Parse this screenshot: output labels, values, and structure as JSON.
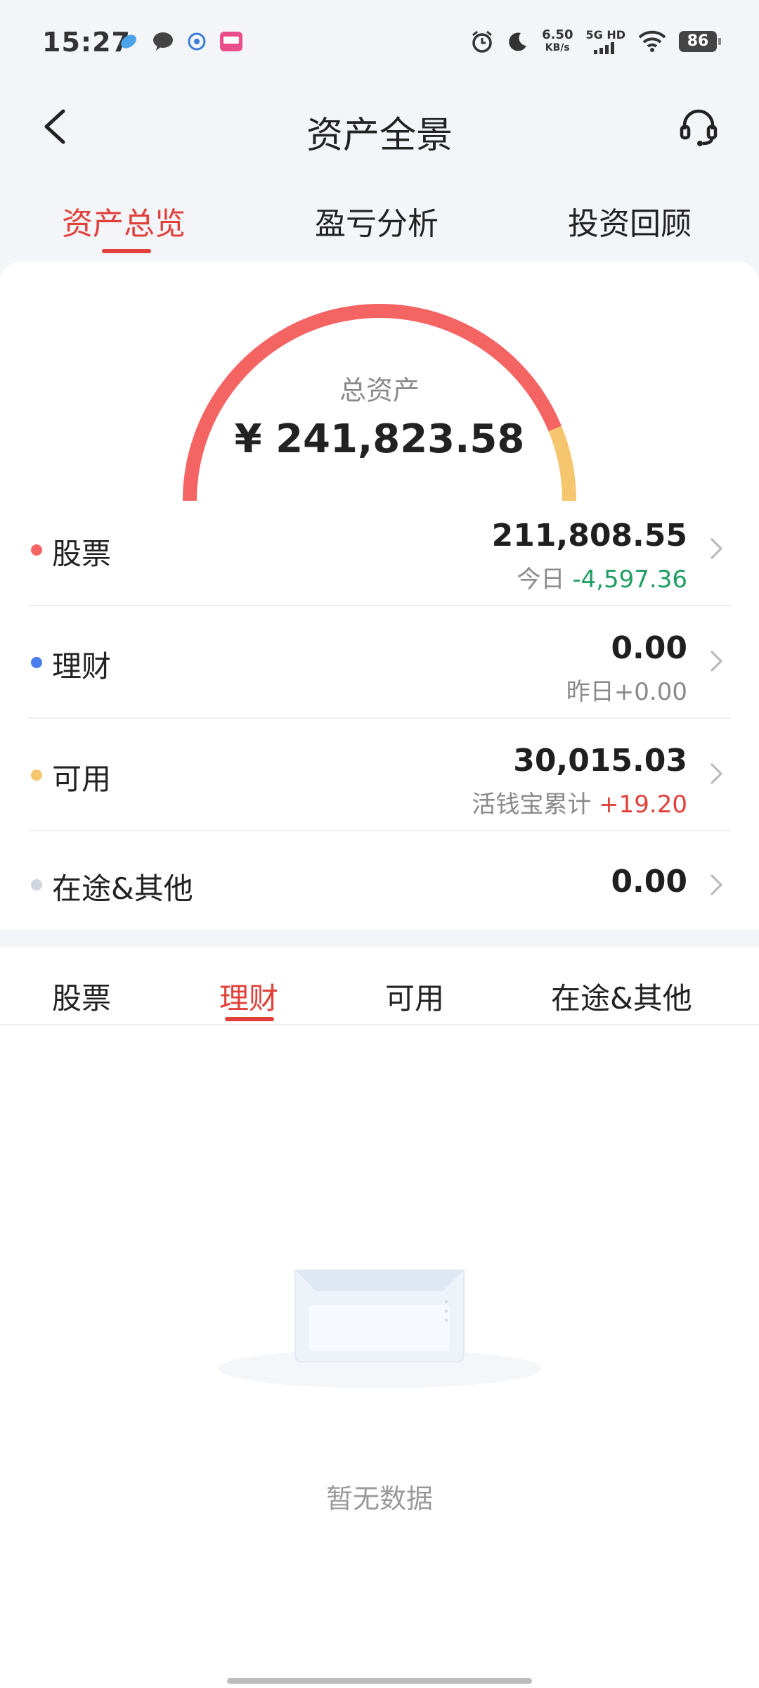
{
  "status_bar": {
    "time": "15:27",
    "speed_top": "6.50",
    "speed_unit": "KB/s",
    "network": "5G HD",
    "battery": "86"
  },
  "header": {
    "title": "资产全景",
    "back_icon": "chevron-left-icon",
    "service_icon": "headset-icon"
  },
  "top_tabs": [
    {
      "label": "资产总览",
      "active": true
    },
    {
      "label": "盈亏分析",
      "active": false
    },
    {
      "label": "投资回顾",
      "active": false
    }
  ],
  "summary": {
    "label": "总资产",
    "value": "¥ 241,823.58",
    "gauge_colors": {
      "stock": "#f36463",
      "available": "#f6c66f"
    },
    "gauge_shares": {
      "stock": 211808.55,
      "available": 30015.03
    }
  },
  "assets": [
    {
      "label": "股票",
      "dot_color": "#f36463",
      "value": "211,808.55",
      "sub_prefix": "今日 ",
      "sub_value": "-4,597.36",
      "sub_tone": "neg"
    },
    {
      "label": "理财",
      "dot_color": "#4a7ef0",
      "value": "0.00",
      "sub_prefix": "昨日",
      "sub_value": "+0.00",
      "sub_tone": "neutral"
    },
    {
      "label": "可用",
      "dot_color": "#f6c66f",
      "value": "30,015.03",
      "sub_prefix": "活钱宝累计 ",
      "sub_value": "+19.20",
      "sub_tone": "pos"
    },
    {
      "label": "在途&其他",
      "dot_color": "#cfd4de",
      "value": "0.00"
    }
  ],
  "sub_tabs": [
    {
      "label": "股票",
      "active": false
    },
    {
      "label": "理财",
      "active": true
    },
    {
      "label": "可用",
      "active": false
    },
    {
      "label": "在途&其他",
      "active": false
    }
  ],
  "empty": {
    "text": "暂无数据"
  }
}
